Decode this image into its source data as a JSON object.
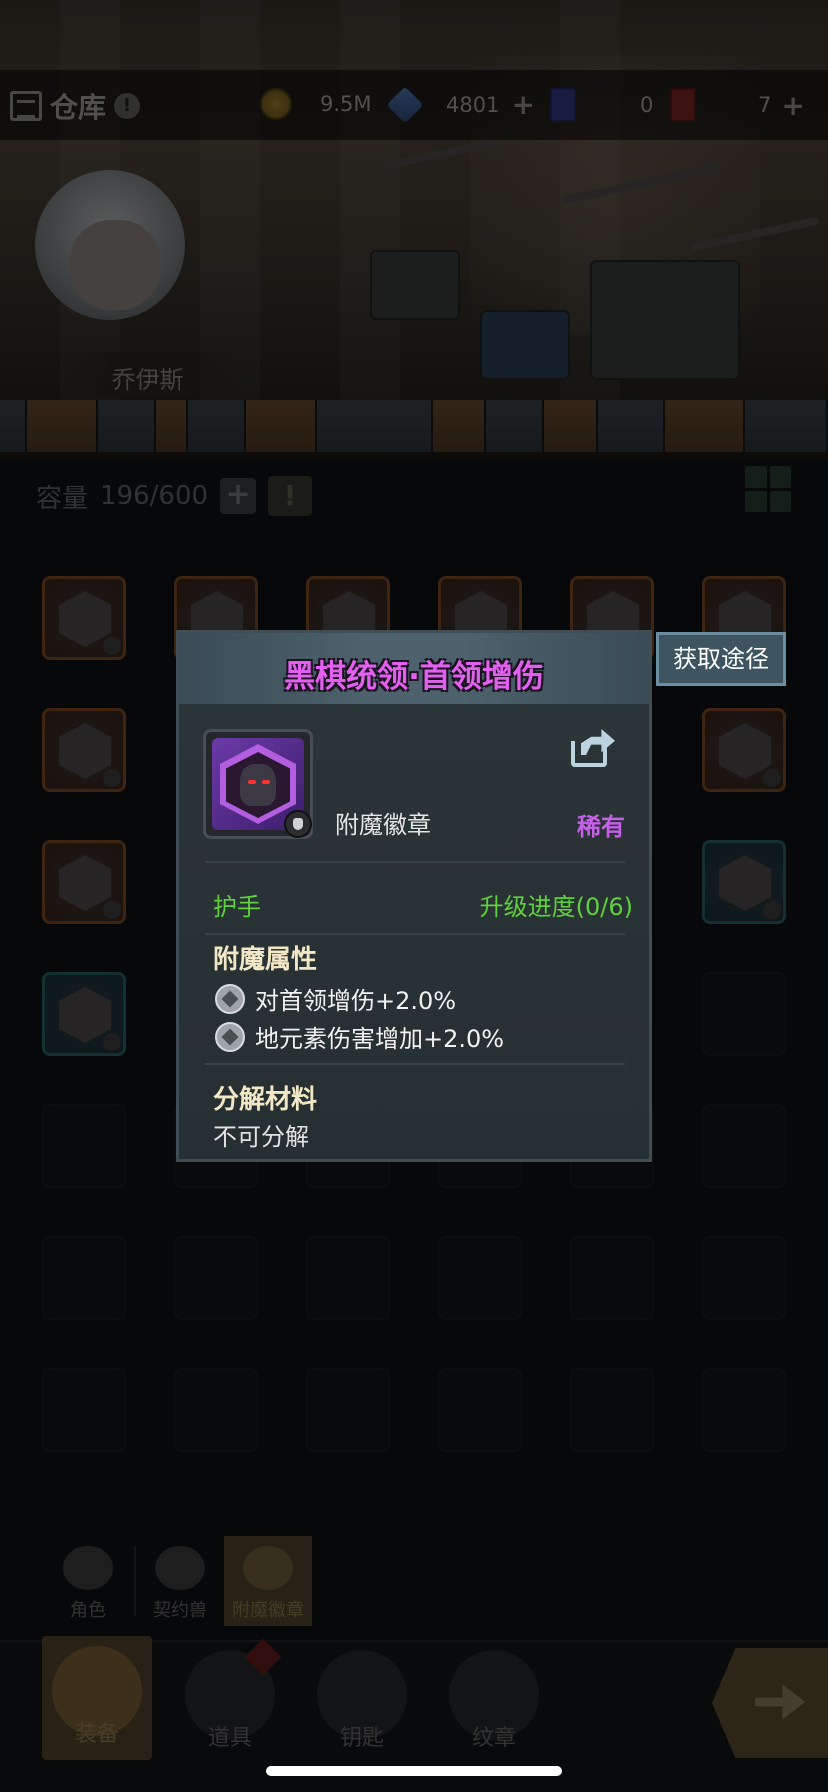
{
  "header": {
    "title": "仓库",
    "resources": [
      {
        "icon": "gold-coin-icon",
        "value": "9.5M"
      },
      {
        "icon": "crystal-gem-icon",
        "value": "4801"
      },
      {
        "icon": "blue-ticket-icon",
        "value": "0"
      },
      {
        "icon": "red-ticket-icon",
        "value": "7"
      }
    ]
  },
  "hero": {
    "name": "乔伊斯"
  },
  "inventory": {
    "capacity_label": "容量",
    "capacity_value": "196/600"
  },
  "popup": {
    "title": "黑棋统领·首领增伤",
    "item_type": "附魔徽章",
    "rarity": "稀有",
    "slot": "护手",
    "upgrade_progress": "升级进度(0/6)",
    "enchant_title": "附魔属性",
    "attributes": [
      "对首领增伤+2.0%",
      "地元素伤害增加+2.0%"
    ],
    "decompose_title": "分解材料",
    "decompose_value": "不可分解",
    "title_color": "#e25ff0",
    "rarity_color": "#c760e8",
    "green_color": "#5fd13d"
  },
  "acquire_button": "获取途径",
  "sub_tabs": [
    {
      "label": "角色",
      "icon": "character-icon"
    },
    {
      "label": "契约兽",
      "icon": "paw-icon"
    },
    {
      "label": "附魔徽章",
      "icon": "enchant-badge-icon",
      "active": true
    }
  ],
  "bottom_nav": [
    {
      "label": "装备",
      "icon": "equipment-icon",
      "active": true
    },
    {
      "label": "道具",
      "icon": "chest-icon",
      "alert": true
    },
    {
      "label": "钥匙",
      "icon": "key-icon"
    },
    {
      "label": "纹章",
      "icon": "emblem-icon"
    }
  ]
}
